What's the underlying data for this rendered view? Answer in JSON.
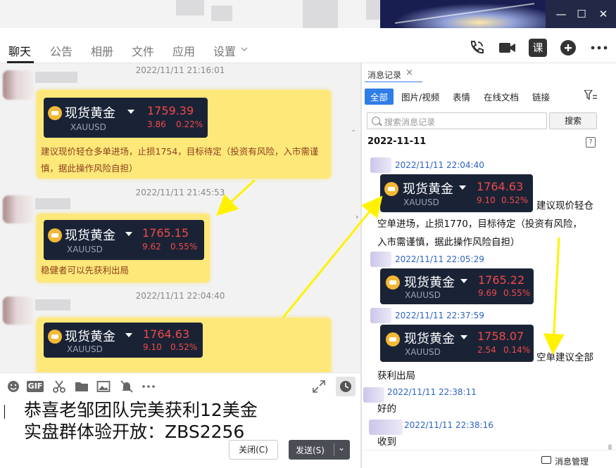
{
  "window": {
    "controls": {
      "minimize": "—",
      "maximize": "☐",
      "close": "✕"
    }
  },
  "tabs": [
    {
      "label": "聊天",
      "active": true
    },
    {
      "label": "公告"
    },
    {
      "label": "相册"
    },
    {
      "label": "文件"
    },
    {
      "label": "应用"
    },
    {
      "label": "设置"
    }
  ],
  "toolbar_icons": [
    "phone-icon",
    "video-call-icon",
    "class-icon",
    "add-icon",
    "more-icon"
  ],
  "toolbar_class_label": "课",
  "chat": {
    "messages": [
      {
        "time": "2022/11/11 21:16:01",
        "card": {
          "name": "现货黄金",
          "symbol": "XAUUSD",
          "price": "1759.39",
          "change": "3.86",
          "change_pct": "0.22%"
        },
        "text_lines": [
          "建议现价轻仓多单进场，止损1754，目标待定（投资有风险，入市需谨",
          "慎，据此操作风险自担）"
        ]
      },
      {
        "time": "2022/11/11 21:45:53",
        "card": {
          "name": "现货黄金",
          "symbol": "XAUUSD",
          "price": "1765.15",
          "change": "9.62",
          "change_pct": "0.55%"
        },
        "text_lines": [
          "稳健者可以先获利出局"
        ]
      },
      {
        "time": "2022/11/11 22:04:40",
        "card": {
          "name": "现货黄金",
          "symbol": "XAUUSD",
          "price": "1764.63",
          "change": "9.10",
          "change_pct": "0.52%"
        },
        "text_lines": []
      }
    ]
  },
  "input_toolbar_icons": [
    "emoji-icon",
    "gif-icon",
    "scissors-icon",
    "folder-icon",
    "image-icon",
    "mute-icon",
    "more-icon",
    "expand-icon",
    "history-icon"
  ],
  "input_toolbar_gif_label": "GIF",
  "compose": {
    "lines": [
      "恭喜老邹团队完美获利12美金",
      "实盘群体验开放：ZBS2256"
    ],
    "close_label": "关闭(C)",
    "send_label": "发送(S)",
    "send_dropdown": "⌄"
  },
  "history": {
    "tab_label": "消息记录",
    "tab_close": "×",
    "filters": [
      {
        "label": "全部",
        "active": true
      },
      {
        "label": "图片/视频"
      },
      {
        "label": "表情"
      },
      {
        "label": "在线文档"
      },
      {
        "label": "链接"
      }
    ],
    "search_placeholder": "搜索消息记录",
    "search_button": "搜索",
    "date": "2022-11-11",
    "calendar_day": "7",
    "entries": [
      {
        "time": "2022/11/11 22:04:40",
        "card": {
          "name": "现货黄金",
          "symbol": "XAUUSD",
          "price": "1764.63",
          "change": "9.10",
          "change_pct": "0.52%"
        },
        "inline_text": "建议现价轻仓",
        "text_lines": [
          "空单进场，止损1770，目标待定（投资有风险，",
          "入市需谨慎，据此操作风险自担）"
        ]
      },
      {
        "time": "2022/11/11 22:05:29",
        "card": {
          "name": "现货黄金",
          "symbol": "XAUUSD",
          "price": "1765.22",
          "change": "9.69",
          "change_pct": "0.55%"
        }
      },
      {
        "time": "2022/11/11 22:37:59",
        "card": {
          "name": "现货黄金",
          "symbol": "XAUUSD",
          "price": "1758.07",
          "change": "2.54",
          "change_pct": "0.14%"
        },
        "inline_text": "空单建议全部",
        "text_lines": [
          "获利出局"
        ]
      },
      {
        "time": "2022/11/11 22:38:11",
        "text_lines": [
          "好的"
        ]
      },
      {
        "time": "2022/11/11 22:38:16",
        "text_lines": [
          "收到"
        ]
      }
    ],
    "footer_label": "消息管理"
  },
  "colors": {
    "bubble": "#fde879",
    "card_bg": "#1a2336",
    "price_red": "#f24848",
    "arrow_yellow": "#fff200",
    "accent_blue": "#2f7de6"
  }
}
